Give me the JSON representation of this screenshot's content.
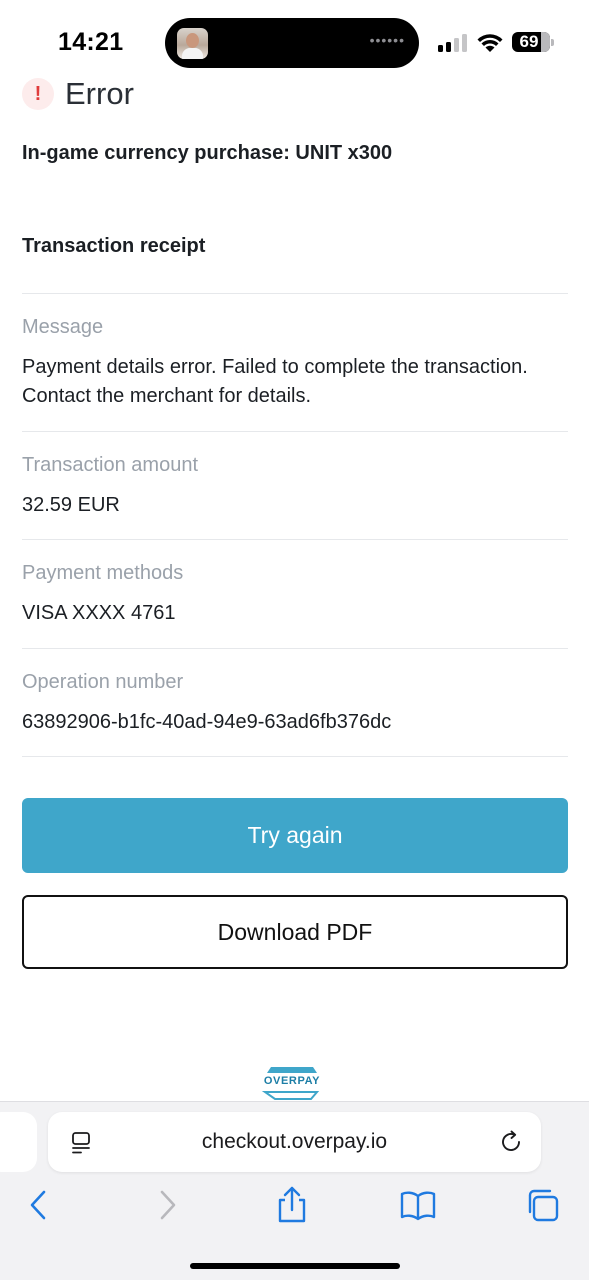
{
  "status_bar": {
    "time": "14:21",
    "battery": "69"
  },
  "header": {
    "title": "Error",
    "icon": "exclamation-icon",
    "icon_glyph": "!"
  },
  "purchase": {
    "title": "In-game currency purchase: UNIT x300"
  },
  "receipt": {
    "title": "Transaction receipt",
    "fields": [
      {
        "label": "Message",
        "value": "Payment details error. Failed to complete the transaction. Contact the merchant for details."
      },
      {
        "label": "Transaction amount",
        "value": "32.59 EUR"
      },
      {
        "label": "Payment methods",
        "value": "VISA XXXX 4761"
      },
      {
        "label": "Operation number",
        "value": "63892906-b1fc-40ad-94e9-63ad6fb376dc"
      }
    ]
  },
  "actions": {
    "try_again": "Try again",
    "download_pdf": "Download PDF"
  },
  "footer": {
    "logo_text": "OVERPAY"
  },
  "browser": {
    "url": "checkout.overpay.io"
  },
  "colors": {
    "primary_button": "#3fa6ca",
    "error": "#e03b3b",
    "ios_blue": "#1f7ae0",
    "logo": "#1d7ea6"
  }
}
